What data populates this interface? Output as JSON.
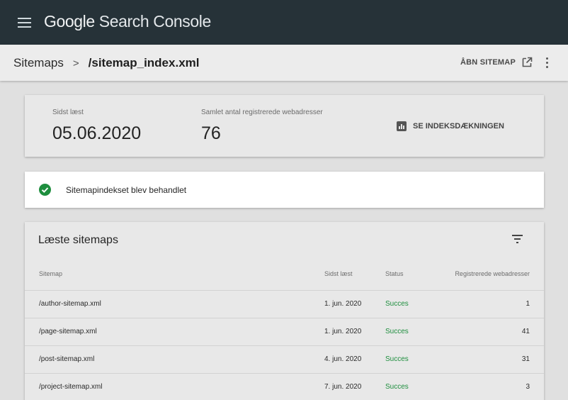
{
  "app": {
    "brand_google": "Google",
    "brand_product": "Search Console"
  },
  "header": {
    "breadcrumb_root": "Sitemaps",
    "breadcrumb_separator": ">",
    "breadcrumb_current": "/sitemap_index.xml",
    "open_sitemap_label": "ÅBN SITEMAP"
  },
  "summary": {
    "last_read_label": "Sidst læst",
    "last_read_value": "05.06.2020",
    "total_urls_label": "Samlet antal registrerede webadresser",
    "total_urls_value": "76",
    "index_coverage_label": "SE INDEKSDÆKNINGEN"
  },
  "status": {
    "message": "Sitemapindekset blev behandlet",
    "color": "#1e8e3e"
  },
  "table": {
    "title": "Læste sitemaps",
    "columns": [
      "Sitemap",
      "Sidst læst",
      "Status",
      "Registrerede webadresser"
    ],
    "rows": [
      {
        "sitemap": "/author-sitemap.xml",
        "last_read": "1. jun. 2020",
        "status": "Succes",
        "urls": "1"
      },
      {
        "sitemap": "/page-sitemap.xml",
        "last_read": "1. jun. 2020",
        "status": "Succes",
        "urls": "41"
      },
      {
        "sitemap": "/post-sitemap.xml",
        "last_read": "4. jun. 2020",
        "status": "Succes",
        "urls": "31"
      },
      {
        "sitemap": "/project-sitemap.xml",
        "last_read": "7. jun. 2020",
        "status": "Succes",
        "urls": "3"
      }
    ]
  },
  "icons": {
    "menu": "menu-icon",
    "open_external": "open-in-new-icon",
    "more": "more-vert-icon",
    "index_coverage": "bar-chart-icon",
    "success": "check-circle-icon",
    "filter": "filter-icon"
  }
}
